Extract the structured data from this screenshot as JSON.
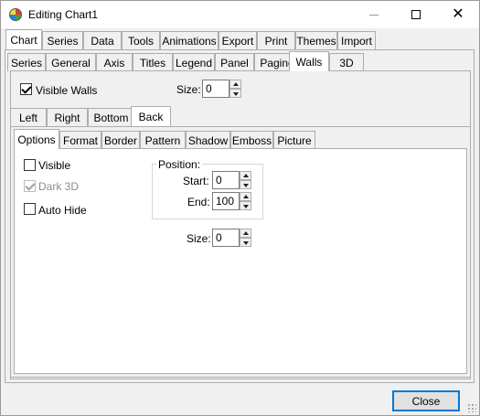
{
  "window": {
    "title": "Editing Chart1",
    "icon": "chart-app-icon",
    "controls": {
      "minimize": "minimize-icon",
      "maximize": "maximize-icon",
      "close": "✕"
    }
  },
  "main_tabs": [
    "Chart",
    "Series",
    "Data",
    "Tools",
    "Animations",
    "Export",
    "Print",
    "Themes",
    "Import"
  ],
  "main_tab_active": "Chart",
  "chart_tabs": [
    "Series",
    "General",
    "Axis",
    "Titles",
    "Legend",
    "Panel",
    "Paging",
    "Walls",
    "3D"
  ],
  "chart_tab_active": "Walls",
  "walls_header": {
    "visible_walls_label": "Visible Walls",
    "visible_walls_checked": true,
    "size_label": "Size:",
    "size_value": "0"
  },
  "wall_tabs": [
    "Left",
    "Right",
    "Bottom",
    "Back"
  ],
  "wall_tab_active": "Back",
  "option_tabs": [
    "Options",
    "Format",
    "Border",
    "Pattern",
    "Shadow",
    "Emboss",
    "Picture"
  ],
  "option_tab_active": "Options",
  "options": {
    "visible_label": "Visible",
    "visible_checked": false,
    "dark3d_label": "Dark 3D",
    "dark3d_checked": true,
    "dark3d_disabled": true,
    "autohide_label": "Auto Hide",
    "autohide_checked": false,
    "position_group_label": "Position:",
    "start_label": "Start:",
    "start_value": "0",
    "end_label": "End:",
    "end_value": "100",
    "size_label": "Size:",
    "size_value": "0"
  },
  "footer": {
    "close_label": "Close"
  }
}
